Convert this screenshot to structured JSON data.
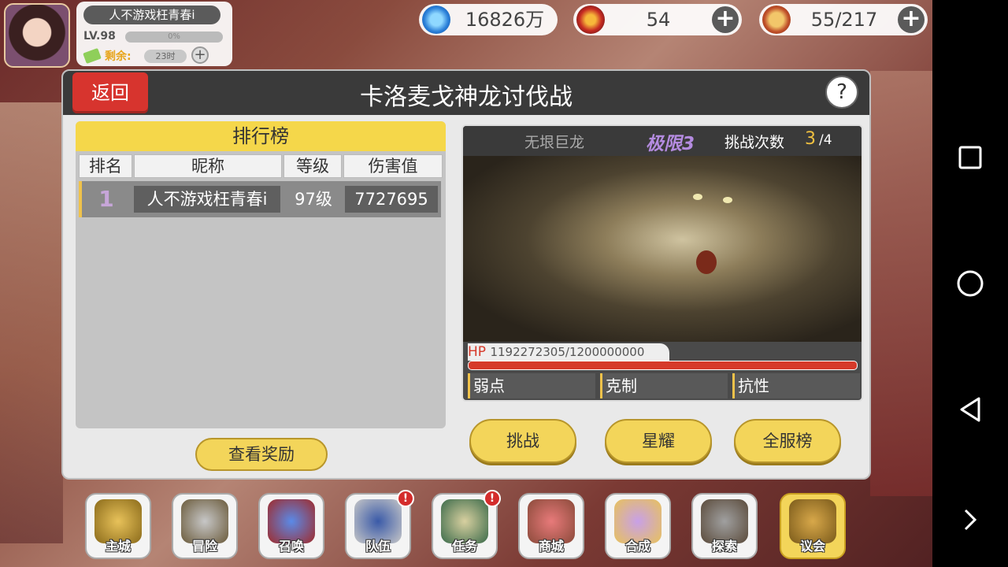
{
  "player": {
    "name": "人不游戏枉青春i",
    "level": "LV.98",
    "xp_percent": "0%",
    "remain_label": "剩余:",
    "remain_value": "23时"
  },
  "currencies": {
    "crystal": "16826万",
    "stamina": "54",
    "food": "55/217"
  },
  "panel": {
    "title": "卡洛麦戈神龙讨伐战",
    "back": "返回",
    "help": "?"
  },
  "leaderboard": {
    "title": "排行榜",
    "columns": [
      "排名",
      "昵称",
      "等级",
      "伤害值"
    ],
    "rows": [
      {
        "rank": "1",
        "name": "人不游戏枉青春i",
        "level": "97级",
        "damage": "7727695"
      }
    ],
    "reward_button": "查看奖励"
  },
  "boss": {
    "name": "无垠巨龙",
    "difficulty": "极限3",
    "attempts_label": "挑战次数",
    "attempts": "3",
    "attempts_max": "/4",
    "hp_label": "HP",
    "hp_value": "1192272305/1200000000",
    "hp_fraction": 0.9936,
    "slots": [
      "弱点",
      "克制",
      "抗性"
    ]
  },
  "actions": {
    "challenge": "挑战",
    "starlight": "星耀",
    "server_rank": "全服榜"
  },
  "bottom_menu": [
    {
      "label": "主城",
      "badge": ""
    },
    {
      "label": "冒险",
      "badge": ""
    },
    {
      "label": "召唤",
      "badge": ""
    },
    {
      "label": "队伍",
      "badge": "!"
    },
    {
      "label": "任务",
      "badge": "!"
    },
    {
      "label": "商城",
      "badge": ""
    },
    {
      "label": "合成",
      "badge": ""
    },
    {
      "label": "探索",
      "badge": ""
    },
    {
      "label": "议会",
      "badge": ""
    }
  ],
  "colors": {
    "accent_yellow": "#f3d55a",
    "back_red": "#d7342e",
    "difficulty_purple": "#b48be0",
    "hp_red": "#d63a2a"
  }
}
